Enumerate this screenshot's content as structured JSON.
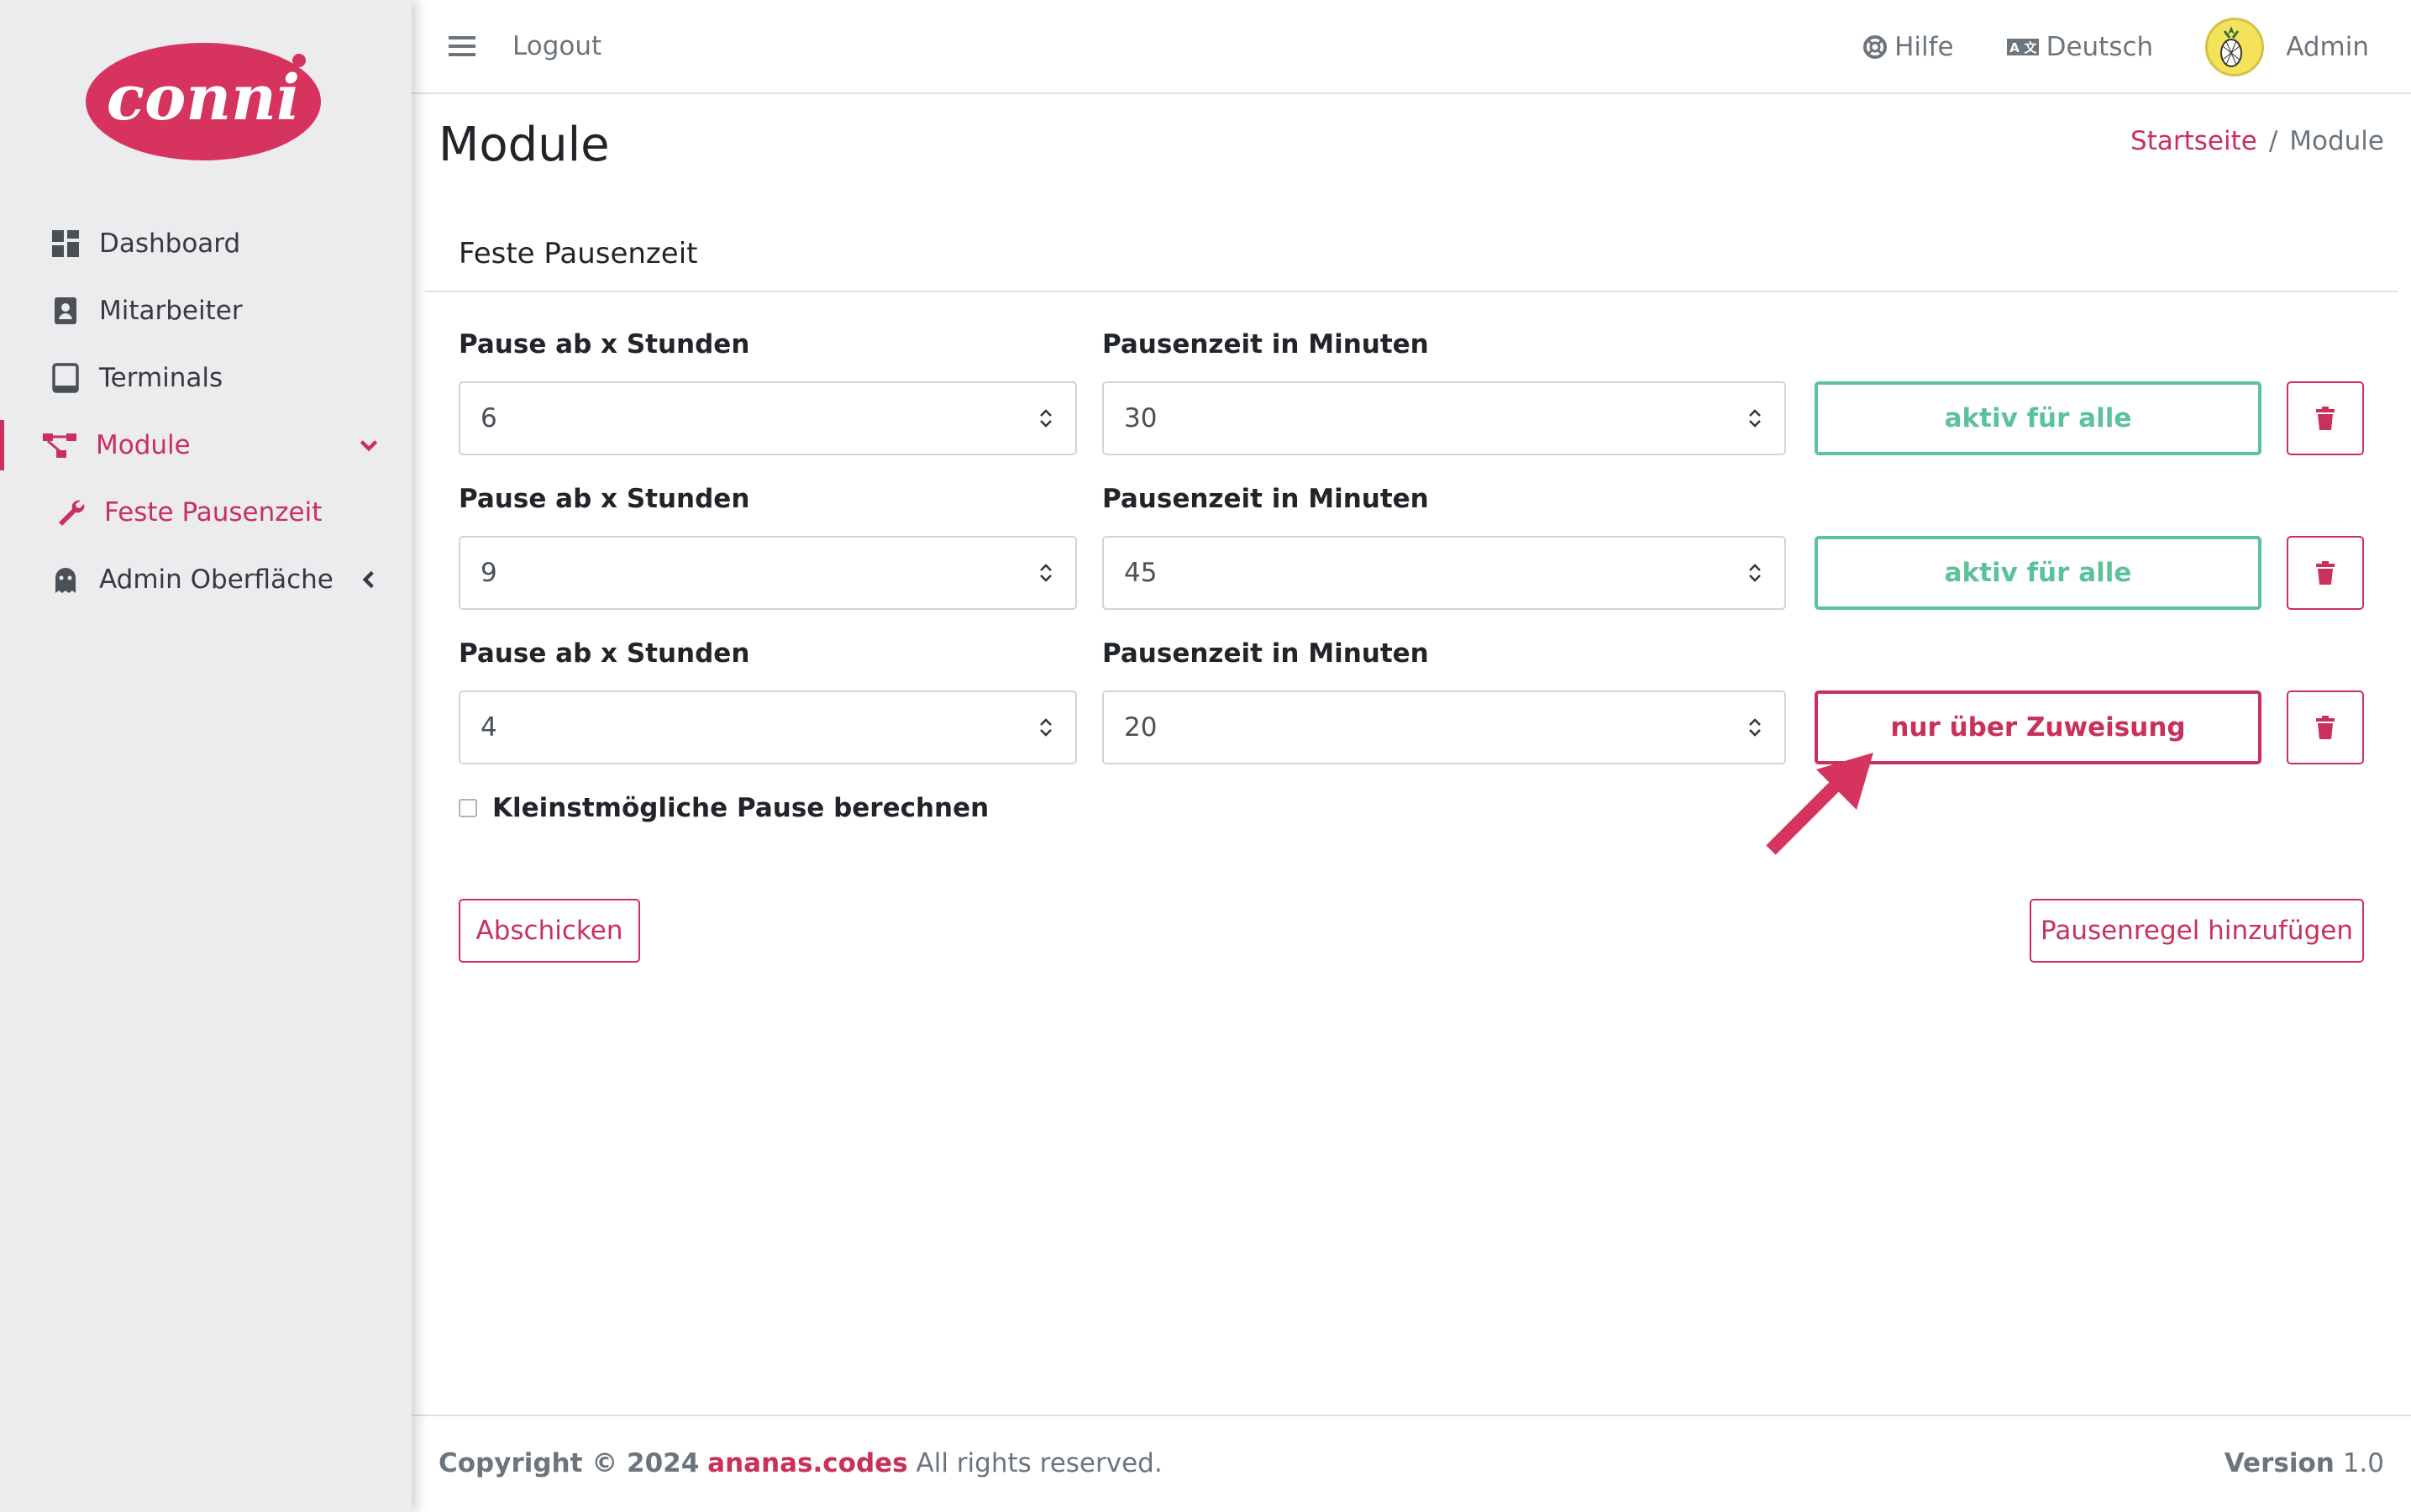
{
  "brand": {
    "logo_text": "conni",
    "primary_color": "#c9305b",
    "success_color": "#5cc29a"
  },
  "sidebar": {
    "items": [
      {
        "label": "Dashboard",
        "icon": "dashboard-grid-icon"
      },
      {
        "label": "Mitarbeiter",
        "icon": "contact-card-icon"
      },
      {
        "label": "Terminals",
        "icon": "tablet-icon"
      },
      {
        "label": "Module",
        "icon": "sitemap-icon",
        "active": true,
        "expanded": true
      },
      {
        "label": "Feste Pausenzeit",
        "icon": "wrench-icon",
        "sub": true
      },
      {
        "label": "Admin Oberfläche",
        "icon": "ghost-icon",
        "collapsed": true
      }
    ]
  },
  "topbar": {
    "logout": "Logout",
    "help": "Hilfe",
    "language": "Deutsch",
    "user": "Admin"
  },
  "page": {
    "title": "Module",
    "breadcrumb": {
      "home": "Startseite",
      "separator": "/",
      "current": "Module"
    }
  },
  "card": {
    "title": "Feste Pausenzeit",
    "rules": [
      {
        "hours_label": "Pause ab x Stunden",
        "hours": "6",
        "minutes_label": "Pausenzeit in Minuten",
        "minutes": "30",
        "status": "aktiv für alle",
        "status_type": "all"
      },
      {
        "hours_label": "Pause ab x Stunden",
        "hours": "9",
        "minutes_label": "Pausenzeit in Minuten",
        "minutes": "45",
        "status": "aktiv für alle",
        "status_type": "all"
      },
      {
        "hours_label": "Pause ab x Stunden",
        "hours": "4",
        "minutes_label": "Pausenzeit in Minuten",
        "minutes": "20",
        "status": "nur über Zuweisung",
        "status_type": "assign"
      }
    ],
    "checkbox_label": "Kleinstmögliche Pause berechnen",
    "checkbox_checked": false,
    "submit_label": "Abschicken",
    "add_rule_label": "Pausenregel hinzufügen"
  },
  "footer": {
    "copyright_prefix": "Copyright © 2024",
    "company": "ananas.codes",
    "rights": "All rights reserved.",
    "version_label": "Version",
    "version_value": "1.0"
  }
}
